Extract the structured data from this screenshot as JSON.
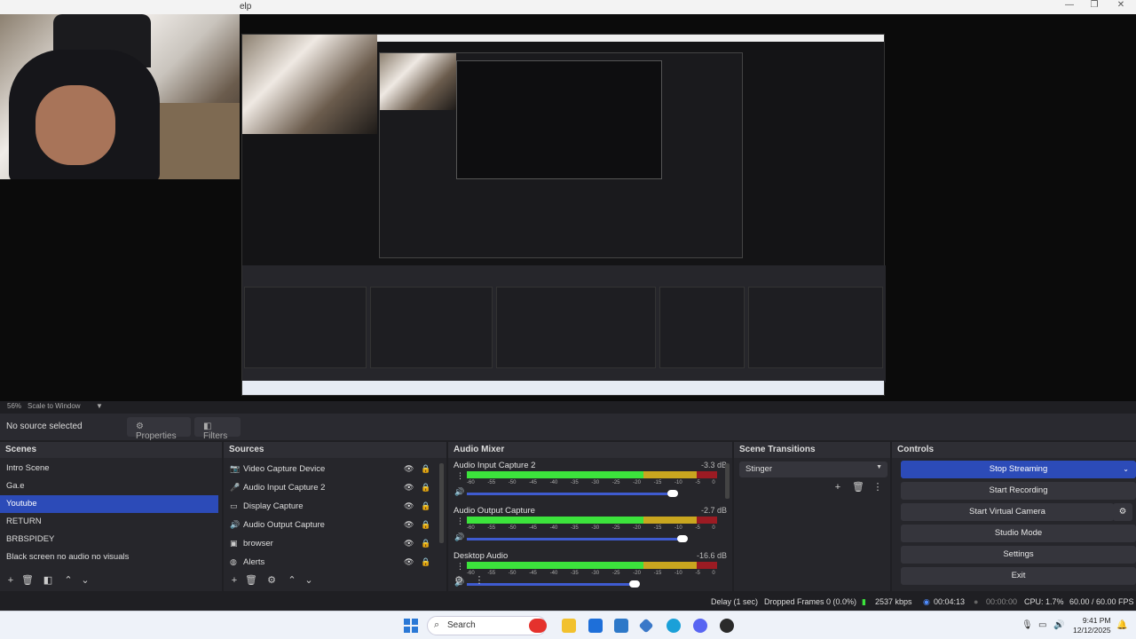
{
  "window": {
    "menu_fragment": "elp"
  },
  "preview": {
    "scale_percent": "56%",
    "scale_mode": "Scale to Window"
  },
  "propbar": {
    "no_source": "No source selected",
    "properties": "Properties",
    "filters": "Filters"
  },
  "scenes": {
    "title": "Scenes",
    "items": [
      "Intro Scene",
      "Ga.e",
      "Youtube",
      "RETURN",
      "BRBSPIDEY",
      "Black screen no audio no visuals"
    ],
    "selected_index": 2
  },
  "sources": {
    "title": "Sources",
    "items": [
      {
        "label": "Video Capture Device",
        "icon": "camera-icon"
      },
      {
        "label": "Audio Input Capture 2",
        "icon": "microphone-icon"
      },
      {
        "label": "Display Capture",
        "icon": "monitor-icon"
      },
      {
        "label": "Audio Output Capture",
        "icon": "speaker-icon"
      },
      {
        "label": "browser",
        "icon": "browser-icon"
      },
      {
        "label": "Alerts",
        "icon": "globe-icon"
      }
    ]
  },
  "mixer": {
    "title": "Audio Mixer",
    "scale_labels": [
      "-60",
      "-55",
      "-50",
      "-45",
      "-40",
      "-35",
      "-30",
      "-25",
      "-20",
      "-15",
      "-10",
      "-5",
      "0"
    ],
    "channels": [
      {
        "name": "Audio Input Capture 2",
        "db": "-3.3 dB",
        "volume": 0.86
      },
      {
        "name": "Audio Output Capture",
        "db": "-2.7 dB",
        "volume": 0.9
      },
      {
        "name": "Desktop Audio",
        "db": "-16.6 dB",
        "volume": 0.7
      }
    ]
  },
  "transitions": {
    "title": "Scene Transitions",
    "selected": "Stinger"
  },
  "controls": {
    "title": "Controls",
    "stop_streaming": "Stop Streaming",
    "start_recording": "Start Recording",
    "start_virtual_camera": "Start Virtual Camera",
    "studio_mode": "Studio Mode",
    "settings": "Settings",
    "exit": "Exit"
  },
  "status": {
    "delay": "Delay (1 sec)",
    "dropped": "Dropped Frames 0 (0.0%)",
    "bitrate": "2537 kbps",
    "stream_time": "00:04:13",
    "rec_time": "00:00:00",
    "cpu": "CPU: 1.7%",
    "fps": "60.00 / 60.00 FPS"
  },
  "taskbar": {
    "search": "Search",
    "time": "9:41 PM",
    "date": "12/12/2025"
  },
  "colors": {
    "accent": "#2c4bb8",
    "meter_green": "#3ce33c",
    "meter_yellow": "#c9a61f",
    "meter_red": "#9b1b23"
  }
}
